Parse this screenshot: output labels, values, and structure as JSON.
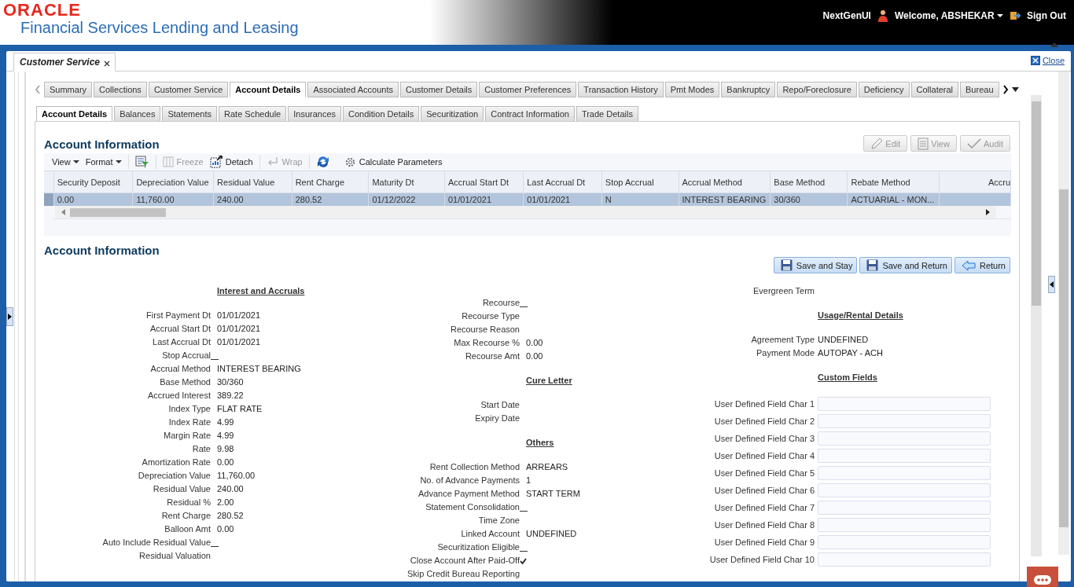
{
  "header": {
    "brand": "ORACLE",
    "product": "Financial Services Lending and Leasing",
    "ui_label": "NextGenUI",
    "welcome": "Welcome, ABSHEKAR",
    "sign_out": "Sign Out"
  },
  "page_tab": {
    "label": "Customer Service",
    "close": "Close"
  },
  "main_tabs": [
    {
      "label": "Summary",
      "selected": false
    },
    {
      "label": "Collections",
      "selected": false
    },
    {
      "label": "Customer Service",
      "selected": false
    },
    {
      "label": "Account Details",
      "selected": true
    },
    {
      "label": "Associated Accounts",
      "selected": false
    },
    {
      "label": "Customer Details",
      "selected": false
    },
    {
      "label": "Customer Preferences",
      "selected": false
    },
    {
      "label": "Transaction History",
      "selected": false
    },
    {
      "label": "Pmt Modes",
      "selected": false
    },
    {
      "label": "Bankruptcy",
      "selected": false
    },
    {
      "label": "Repo/Foreclosure",
      "selected": false
    },
    {
      "label": "Deficiency",
      "selected": false
    },
    {
      "label": "Collateral",
      "selected": false
    },
    {
      "label": "Bureau",
      "selected": false
    }
  ],
  "sub_tabs": [
    {
      "label": "Account Details",
      "selected": true
    },
    {
      "label": "Balances",
      "selected": false
    },
    {
      "label": "Statements",
      "selected": false
    },
    {
      "label": "Rate Schedule",
      "selected": false
    },
    {
      "label": "Insurances",
      "selected": false
    },
    {
      "label": "Condition Details",
      "selected": false
    },
    {
      "label": "Securitization",
      "selected": false
    },
    {
      "label": "Contract Information",
      "selected": false
    },
    {
      "label": "Trade Details",
      "selected": false
    }
  ],
  "account_section": {
    "title": "Account Information",
    "actions": [
      {
        "label": "Edit",
        "disabled": true
      },
      {
        "label": "View",
        "disabled": true
      },
      {
        "label": "Audit",
        "disabled": true
      }
    ],
    "toolbar": {
      "view": "View",
      "format": "Format",
      "freeze": {
        "label": "Freeze",
        "disabled": true
      },
      "detach": {
        "label": "Detach",
        "disabled": false
      },
      "wrap": {
        "label": "Wrap",
        "disabled": true
      },
      "calculate": "Calculate Parameters"
    },
    "table": {
      "columns": [
        "Security Deposit",
        "Depreciation Value",
        "Residual Value",
        "Rent Charge",
        "Maturity Dt",
        "Accrual Start Dt",
        "Last Accrual Dt",
        "Stop Accrual",
        "Accrual Method",
        "Base Method",
        "Rebate Method",
        "Accru"
      ],
      "rows": [
        {
          "selected": true,
          "cells": [
            "0.00",
            "11,760.00",
            "240.00",
            "280.52",
            "01/12/2022",
            "01/01/2021",
            "01/01/2021",
            "N",
            "INTEREST BEARING",
            "30/360",
            "ACTUARIAL - MON..."
          ]
        }
      ]
    }
  },
  "detail_section": {
    "title": "Account Information",
    "buttons": [
      {
        "label": "Save and Stay",
        "kind": "save"
      },
      {
        "label": "Save and Return",
        "kind": "save"
      },
      {
        "label": "Return",
        "kind": "return"
      }
    ],
    "columns": [
      [
        {
          "kind": "heading",
          "label": "Interest and Accruals"
        },
        {
          "kind": "text",
          "label": "First Payment Dt",
          "value": "01/01/2021"
        },
        {
          "kind": "text",
          "label": "Accrual Start Dt",
          "value": "01/01/2021"
        },
        {
          "kind": "text",
          "label": "Last Accrual Dt",
          "value": "01/01/2021"
        },
        {
          "kind": "check",
          "label": "Stop Accrual",
          "checked": false
        },
        {
          "kind": "text",
          "label": "Accrual Method",
          "value": "INTEREST BEARING"
        },
        {
          "kind": "text",
          "label": "Base Method",
          "value": "30/360"
        },
        {
          "kind": "text",
          "label": "Accrued Interest",
          "value": "389.22"
        },
        {
          "kind": "text",
          "label": "Index Type",
          "value": "FLAT RATE"
        },
        {
          "kind": "text",
          "label": "Index Rate",
          "value": "4.99"
        },
        {
          "kind": "text",
          "label": "Margin Rate",
          "value": "4.99"
        },
        {
          "kind": "text",
          "label": "Rate",
          "value": "9.98"
        },
        {
          "kind": "text",
          "label": "Amortization Rate",
          "value": "0.00"
        },
        {
          "kind": "text",
          "label": "Depreciation Value",
          "value": "11,760.00"
        },
        {
          "kind": "text",
          "label": "Residual Value",
          "value": "240.00"
        },
        {
          "kind": "text",
          "label": "Residual %",
          "value": "2.00"
        },
        {
          "kind": "text",
          "label": "Rent Charge",
          "value": "280.52"
        },
        {
          "kind": "text",
          "label": "Balloon Amt",
          "value": "0.00"
        },
        {
          "kind": "check",
          "label": "Auto Include Residual Value",
          "checked": false
        },
        {
          "kind": "text",
          "label": "Residual Valuation"
        }
      ],
      [
        {
          "kind": "check",
          "label": "Recourse",
          "checked": false
        },
        {
          "kind": "text",
          "label": "Recourse Type"
        },
        {
          "kind": "text",
          "label": "Recourse Reason"
        },
        {
          "kind": "text",
          "label": "Max Recourse %",
          "value": "0.00"
        },
        {
          "kind": "text",
          "label": "Recourse Amt",
          "value": "0.00"
        },
        {
          "kind": "heading",
          "label": "Cure Letter"
        },
        {
          "kind": "text",
          "label": "Start Date"
        },
        {
          "kind": "text",
          "label": "Expiry Date"
        },
        {
          "kind": "heading",
          "label": "Others"
        },
        {
          "kind": "text",
          "label": "Rent Collection Method",
          "value": "ARREARS"
        },
        {
          "kind": "text",
          "label": "No. of Advance Payments",
          "value": "1"
        },
        {
          "kind": "text",
          "label": "Advance Payment Method",
          "value": "START TERM"
        },
        {
          "kind": "check",
          "label": "Statement Consolidation",
          "checked": false
        },
        {
          "kind": "text",
          "label": "Time Zone"
        },
        {
          "kind": "text",
          "label": "Linked Account",
          "value": "UNDEFINED"
        },
        {
          "kind": "check",
          "label": "Securitization Eligible",
          "checked": false
        },
        {
          "kind": "check",
          "label": "Close Account After Paid-Off",
          "checked": true
        },
        {
          "kind": "text",
          "label": "Skip Credit Bureau Reporting"
        }
      ],
      [
        {
          "kind": "text",
          "label": "Evergreen Term"
        },
        {
          "kind": "heading",
          "label": "Usage/Rental Details"
        },
        {
          "kind": "text",
          "label": "Agreement Type",
          "value": "UNDEFINED"
        },
        {
          "kind": "text",
          "label": "Payment Mode",
          "value": "AUTOPAY - ACH"
        },
        {
          "kind": "heading",
          "label": "Custom Fields"
        },
        {
          "kind": "input",
          "label": "User Defined Field Char 1"
        },
        {
          "kind": "input",
          "label": "User Defined Field Char 2"
        },
        {
          "kind": "input",
          "label": "User Defined Field Char 3"
        },
        {
          "kind": "input",
          "label": "User Defined Field Char 4"
        },
        {
          "kind": "input",
          "label": "User Defined Field Char 5"
        },
        {
          "kind": "input",
          "label": "User Defined Field Char 6"
        },
        {
          "kind": "input",
          "label": "User Defined Field Char 7"
        },
        {
          "kind": "input",
          "label": "User Defined Field Char 8"
        },
        {
          "kind": "input",
          "label": "User Defined Field Char 9"
        },
        {
          "kind": "input",
          "label": "User Defined Field Char 10"
        }
      ]
    ]
  }
}
